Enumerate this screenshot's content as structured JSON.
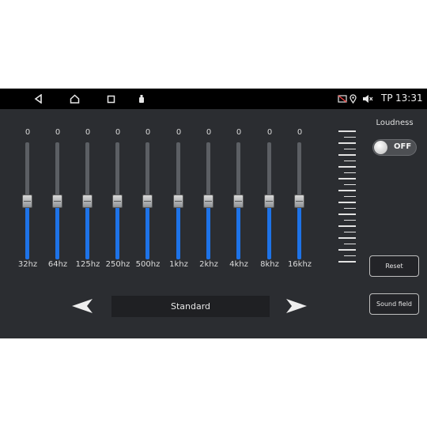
{
  "status_bar": {
    "icons": [
      "back-icon",
      "home-icon",
      "recent-apps-icon",
      "usb-icon",
      "no-signal-icon",
      "location-icon",
      "volume-muted-icon"
    ],
    "indicator": "TP",
    "time": "13:31"
  },
  "equalizer": {
    "bands": [
      {
        "label": "32hz",
        "value": "0",
        "level": 0.5
      },
      {
        "label": "64hz",
        "value": "0",
        "level": 0.5
      },
      {
        "label": "125hz",
        "value": "0",
        "level": 0.5
      },
      {
        "label": "250hz",
        "value": "0",
        "level": 0.5
      },
      {
        "label": "500hz",
        "value": "0",
        "level": 0.5
      },
      {
        "label": "1khz",
        "value": "0",
        "level": 0.5
      },
      {
        "label": "2khz",
        "value": "0",
        "level": 0.5
      },
      {
        "label": "4khz",
        "value": "0",
        "level": 0.5
      },
      {
        "label": "8khz",
        "value": "0",
        "level": 0.5
      },
      {
        "label": "16khz",
        "value": "0",
        "level": 0.5
      }
    ],
    "preset": "Standard"
  },
  "loudness": {
    "label": "Loudness",
    "state": "OFF"
  },
  "buttons": {
    "reset": "Reset",
    "sound_field": "Sound field"
  },
  "colors": {
    "accent": "#1e73e8",
    "background": "#2b2d31",
    "status_bar": "#000000"
  }
}
